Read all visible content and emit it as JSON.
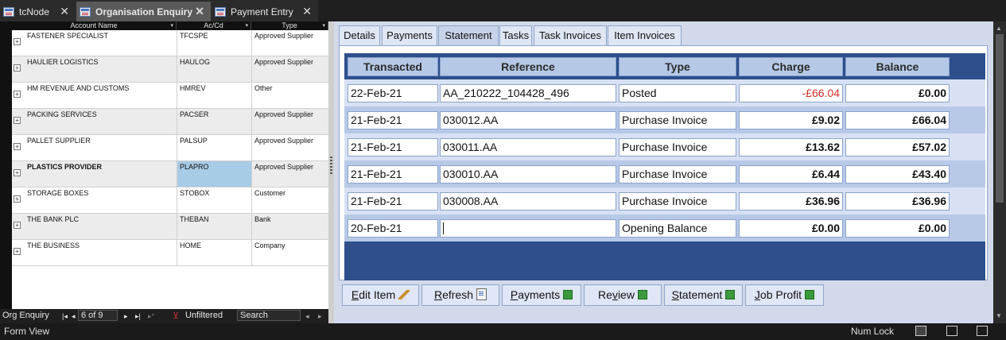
{
  "doc_tabs": [
    {
      "label": "tcNode",
      "active": false
    },
    {
      "label": "Organisation Enquiry",
      "active": true
    },
    {
      "label": "Payment Entry",
      "active": false
    }
  ],
  "datasheet": {
    "columns": [
      "Account Name",
      "Ac/Cd",
      "Type"
    ],
    "rows": [
      {
        "name": "FASTENER SPECIALIST",
        "code": "TFCSPE",
        "type": "Approved Supplier"
      },
      {
        "name": "HAULIER LOGISTICS",
        "code": "HAULOG",
        "type": "Approved Supplier"
      },
      {
        "name": "HM REVENUE AND CUSTOMS",
        "code": "HMREV",
        "type": "Other"
      },
      {
        "name": "PACKING SERVICES",
        "code": "PACSER",
        "type": "Approved Supplier"
      },
      {
        "name": "PALLET SUPPLIER",
        "code": "PALSUP",
        "type": "Approved Supplier"
      },
      {
        "name": "PLASTICS PROVIDER",
        "code": "PLAPRO",
        "type": "Approved Supplier"
      },
      {
        "name": "STORAGE BOXES",
        "code": "STOBOX",
        "type": "Customer"
      },
      {
        "name": "THE BANK PLC",
        "code": "THEBAN",
        "type": "Bank"
      },
      {
        "name": "THE BUSINESS",
        "code": "HOME",
        "type": "Company"
      }
    ],
    "selected_index": 5
  },
  "nav": {
    "label": "Org Enquiry",
    "record": "6 of 9",
    "filter": "Unfiltered",
    "search": "Search"
  },
  "panel_tabs": [
    "Details",
    "Payments",
    "Statement",
    "Tasks",
    "Task Invoices",
    "Item Invoices"
  ],
  "active_panel_tab": "Statement",
  "statement": {
    "columns": [
      "Transacted",
      "Reference",
      "Type",
      "Charge",
      "Balance"
    ],
    "rows": [
      {
        "date": "22-Feb-21",
        "ref": "AA_210222_104428_496",
        "type": "Posted",
        "charge": "-£66.04",
        "balance": "£0.00",
        "negative": true
      },
      {
        "date": "21-Feb-21",
        "ref": "030012.AA",
        "type": "Purchase Invoice",
        "charge": "£9.02",
        "balance": "£66.04",
        "negative": false
      },
      {
        "date": "21-Feb-21",
        "ref": "030011.AA",
        "type": "Purchase Invoice",
        "charge": "£13.62",
        "balance": "£57.02",
        "negative": false
      },
      {
        "date": "21-Feb-21",
        "ref": "030010.AA",
        "type": "Purchase Invoice",
        "charge": "£6.44",
        "balance": "£43.40",
        "negative": false
      },
      {
        "date": "21-Feb-21",
        "ref": "030008.AA",
        "type": "Purchase Invoice",
        "charge": "£36.96",
        "balance": "£36.96",
        "negative": false
      },
      {
        "date": "20-Feb-21",
        "ref": "",
        "type": "Opening Balance",
        "charge": "£0.00",
        "balance": "£0.00",
        "negative": false
      }
    ]
  },
  "buttons": [
    {
      "label": "Edit Item",
      "icon": "pencil-icon"
    },
    {
      "label": "Refresh",
      "icon": "document-icon"
    },
    {
      "label": "Payments",
      "icon": "green-square-icon"
    },
    {
      "label": "Review",
      "icon": "green-square-icon"
    },
    {
      "label": "Statement",
      "icon": "green-square-icon"
    },
    {
      "label": "Job Profit",
      "icon": "green-square-icon"
    }
  ],
  "status": {
    "form_view": "Form View",
    "num_lock": "Num Lock"
  },
  "colors": {
    "accent": "#2e4f8c",
    "negative": "#d1302a",
    "selected_cell": "#a8cbe6"
  }
}
